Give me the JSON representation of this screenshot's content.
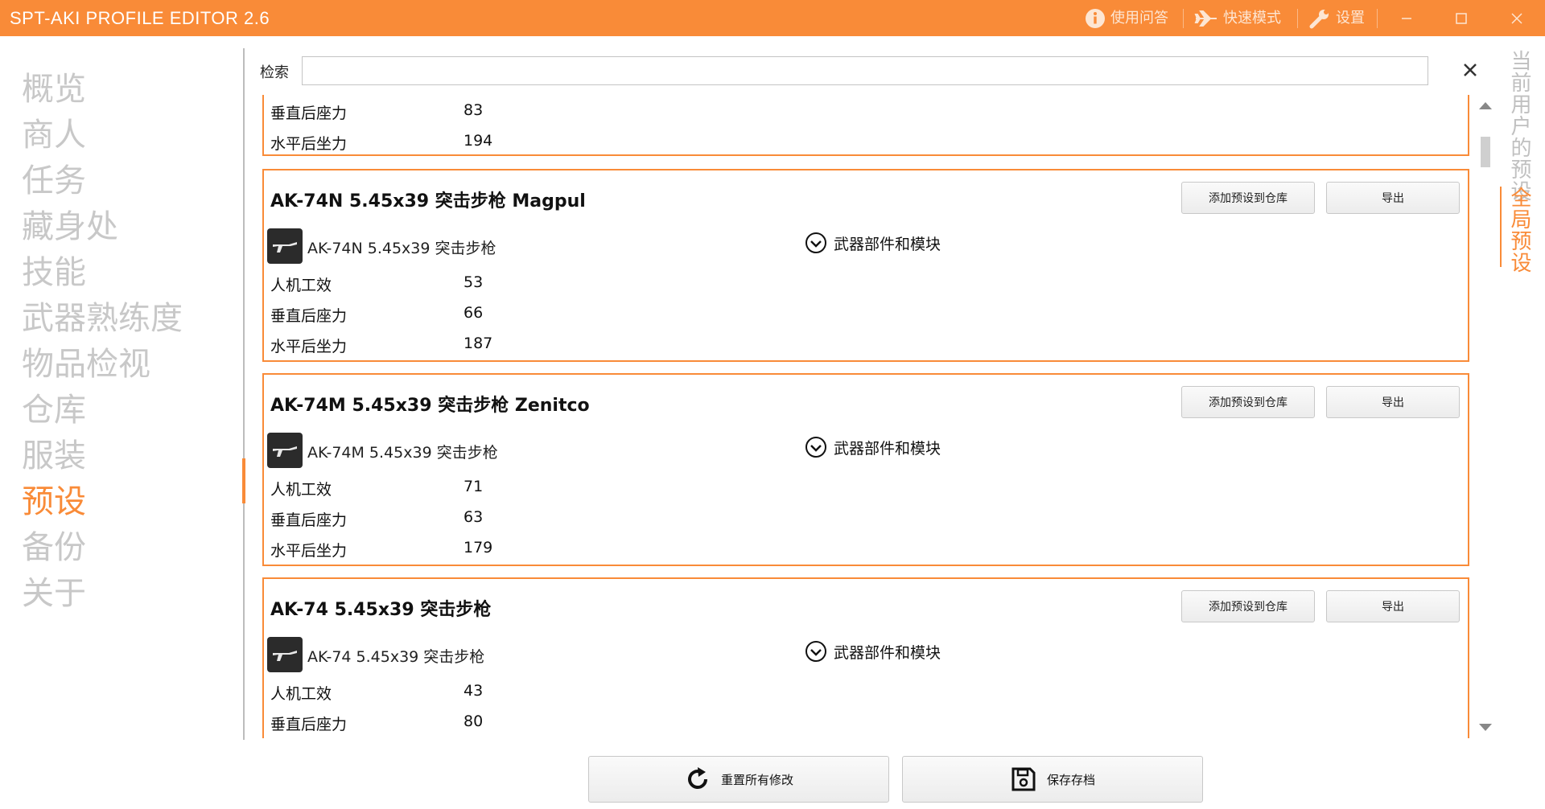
{
  "titlebar": {
    "app_title": "SPT-AKI PROFILE EDITOR  2.6",
    "faq_label": "使用问答",
    "quick_mode_label": "快速模式",
    "settings_label": "设置",
    "accent_color": "#f98b38"
  },
  "nav": {
    "items": [
      {
        "label": "概览"
      },
      {
        "label": "商人"
      },
      {
        "label": "任务"
      },
      {
        "label": "藏身处"
      },
      {
        "label": "技能"
      },
      {
        "label": "武器熟练度"
      },
      {
        "label": "物品检视"
      },
      {
        "label": "仓库"
      },
      {
        "label": "服装"
      },
      {
        "label": "预设"
      },
      {
        "label": "备份"
      },
      {
        "label": "关于"
      }
    ],
    "active": "预设"
  },
  "search": {
    "label": "检索",
    "value": ""
  },
  "stat_labels": {
    "ergonomics": "人机工效",
    "vertical_recoil": "垂直后座力",
    "horizontal_recoil": "水平后坐力"
  },
  "presets": [
    {
      "partial": true,
      "vertical_recoil": "83",
      "horizontal_recoil": "194"
    },
    {
      "title": "AK-74N 5.45x39 突击步枪 Magpul",
      "weapon": "AK-74N 5.45x39 突击步枪",
      "ergonomics": "53",
      "vertical_recoil": "66",
      "horizontal_recoil": "187"
    },
    {
      "title": "AK-74M 5.45x39 突击步枪 Zenitco",
      "weapon": "AK-74M 5.45x39 突击步枪",
      "ergonomics": "71",
      "vertical_recoil": "63",
      "horizontal_recoil": "179"
    },
    {
      "title": "AK-74 5.45x39 突击步枪",
      "weapon": "AK-74 5.45x39 突击步枪",
      "ergonomics": "43",
      "vertical_recoil": "80"
    }
  ],
  "card_buttons": {
    "add_to_stash": "添加预设到仓库",
    "export": "导出",
    "mods_toggle": "武器部件和模块"
  },
  "right_tabs": {
    "user_presets": "当前用户的预设",
    "global_presets": "全局预设",
    "active": "全局预设"
  },
  "bottom": {
    "reset_label": "重置所有修改",
    "save_label": "保存存档"
  }
}
